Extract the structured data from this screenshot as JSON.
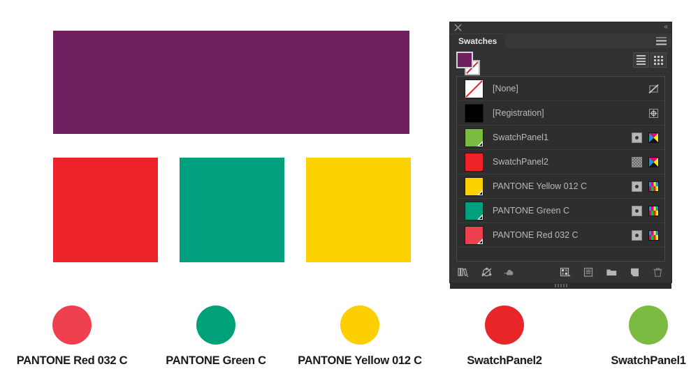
{
  "artwork": {
    "purple_bar": {
      "name": "purple-rectangle",
      "color": "#6E2060"
    },
    "squares": [
      {
        "name": "red-square",
        "color": "#EE2229"
      },
      {
        "name": "green-square",
        "color": "#00A07E"
      },
      {
        "name": "yellow-square",
        "color": "#FDD200"
      }
    ]
  },
  "legend": [
    {
      "label": "PANTONE Red 032 C",
      "color": "#EF4050"
    },
    {
      "label": "PANTONE Green C",
      "color": "#00A078"
    },
    {
      "label": "PANTONE Yellow 012 C",
      "color": "#FDCE00"
    },
    {
      "label": "SwatchPanel2",
      "color": "#E8262A"
    },
    {
      "label": "SwatchPanel1",
      "color": "#7CBB42"
    }
  ],
  "panel": {
    "tab_label": "Swatches",
    "close_icon": "close-icon",
    "collapse_icon": "collapse-to-icons-icon",
    "menu_icon": "panel-menu-icon",
    "fill_color": "#6E2060",
    "stroke_color": "none",
    "view_toggles": [
      {
        "name": "list-view-button",
        "icon": "list-view-icon",
        "selected": true
      },
      {
        "name": "grid-view-button",
        "icon": "grid-view-icon",
        "selected": false
      }
    ],
    "swatches": [
      {
        "name": "[None]",
        "color": "#FFFFFF",
        "kind": "none",
        "spot": false,
        "mode": "none",
        "right_icon": "none-color-icon"
      },
      {
        "name": "[Registration]",
        "color": "#000000",
        "kind": "registration",
        "spot": false,
        "mode": "none",
        "right_icon": "registration-icon"
      },
      {
        "name": "SwatchPanel1",
        "color": "#7CBB42",
        "kind": "spot",
        "spot": true,
        "mode": "cmyk",
        "right_icon": "spot-color-icon"
      },
      {
        "name": "SwatchPanel2",
        "color": "#EE2229",
        "kind": "process",
        "spot": false,
        "mode": "cmyk",
        "right_icon": "process-color-icon"
      },
      {
        "name": "PANTONE Yellow 012 C",
        "color": "#FDD200",
        "kind": "spot",
        "spot": true,
        "mode": "spot",
        "right_icon": "spot-color-icon"
      },
      {
        "name": "PANTONE Green C",
        "color": "#00A07E",
        "kind": "spot",
        "spot": true,
        "mode": "spot",
        "right_icon": "spot-color-icon"
      },
      {
        "name": "PANTONE Red 032 C",
        "color": "#EF4050",
        "kind": "spot",
        "spot": true,
        "mode": "spot",
        "right_icon": "spot-color-icon"
      }
    ],
    "footer_buttons_left": [
      {
        "name": "swatch-libraries-menu-button",
        "icon": "books-library-icon"
      },
      {
        "name": "color-group-button",
        "icon": "color-group-icon"
      },
      {
        "name": "add-to-library-button",
        "icon": "cloud-upload-icon"
      }
    ],
    "footer_buttons_right": [
      {
        "name": "show-swatch-kinds-menu-button",
        "icon": "swatch-kinds-icon"
      },
      {
        "name": "swatch-options-button",
        "icon": "swatch-options-icon"
      },
      {
        "name": "new-color-group-button",
        "icon": "folder-icon"
      },
      {
        "name": "new-swatch-button",
        "icon": "new-swatch-icon"
      },
      {
        "name": "delete-swatch-button",
        "icon": "trash-icon"
      }
    ]
  }
}
